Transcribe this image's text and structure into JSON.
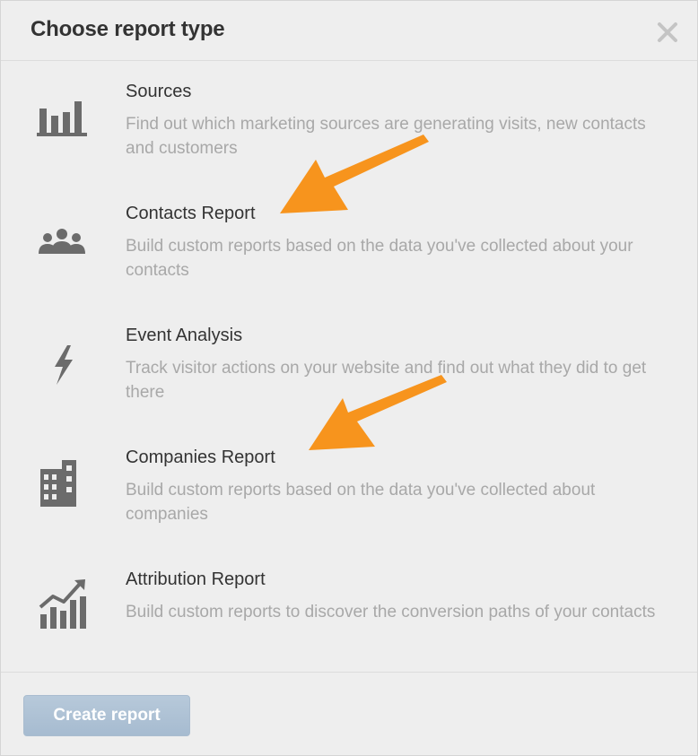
{
  "dialog": {
    "title": "Choose report type",
    "close_icon": "close-icon",
    "create_button_label": "Create report"
  },
  "reports": [
    {
      "name": "Sources",
      "description": "Find out which marketing sources are generating visits, new contacts and customers",
      "icon": "bar-chart-icon"
    },
    {
      "name": "Contacts Report",
      "description": "Build custom reports based on the data you've collected about your contacts",
      "icon": "people-icon"
    },
    {
      "name": "Event Analysis",
      "description": "Track visitor actions on your website and find out what they did to get there",
      "icon": "lightning-icon"
    },
    {
      "name": "Companies Report",
      "description": "Build custom reports based on the data you've collected about companies",
      "icon": "buildings-icon"
    },
    {
      "name": "Attribution Report",
      "description": "Build custom reports to discover the conversion paths of your contacts",
      "icon": "trend-chart-icon"
    }
  ],
  "colors": {
    "background": "#eeeeee",
    "title": "#333333",
    "description": "#a8a8a8",
    "icon": "#6b6b6b",
    "annotation_arrow": "#f7941d",
    "button": "#b2c5d8"
  }
}
